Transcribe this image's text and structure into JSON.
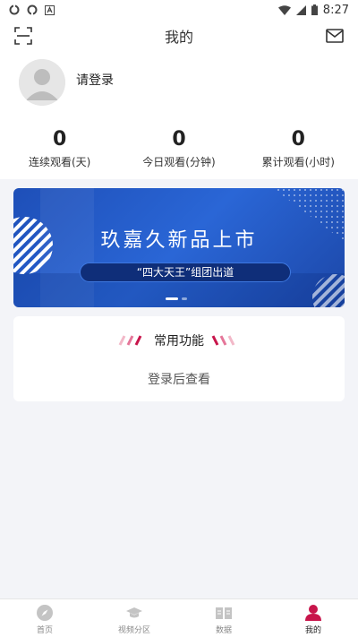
{
  "status_bar": {
    "time": "8:27",
    "left_icons": [
      "sync-icon",
      "sync-icon",
      "notification-a-icon"
    ],
    "right_icons": [
      "wifi-icon",
      "signal-icon",
      "battery-icon"
    ]
  },
  "header": {
    "title": "我的",
    "left_icon": "scan-icon",
    "right_icon": "mail-icon"
  },
  "profile": {
    "login_text": "请登录",
    "avatar_icon": "avatar-icon"
  },
  "stats": [
    {
      "value": "0",
      "label": "连续观看(天)"
    },
    {
      "value": "0",
      "label": "今日观看(分钟)"
    },
    {
      "value": "0",
      "label": "累计观看(小时)"
    }
  ],
  "banner": {
    "title": "玖嘉久新品上市",
    "subtitle": "“四大天王”组团出道",
    "slides": 2,
    "active_slide": 1
  },
  "functions": {
    "title": "常用功能",
    "hint": "登录后查看"
  },
  "tabbar": {
    "items": [
      {
        "label": "首页",
        "icon": "compass-icon",
        "active": false
      },
      {
        "label": "视频分区",
        "icon": "graduation-cap-icon",
        "active": false
      },
      {
        "label": "数据",
        "icon": "book-icon",
        "active": false
      },
      {
        "label": "我的",
        "icon": "user-icon",
        "active": true
      }
    ]
  },
  "colors": {
    "accent": "#c8154b",
    "banner_blue": "#2a66d6",
    "inactive_icon": "#c4c4c4"
  }
}
